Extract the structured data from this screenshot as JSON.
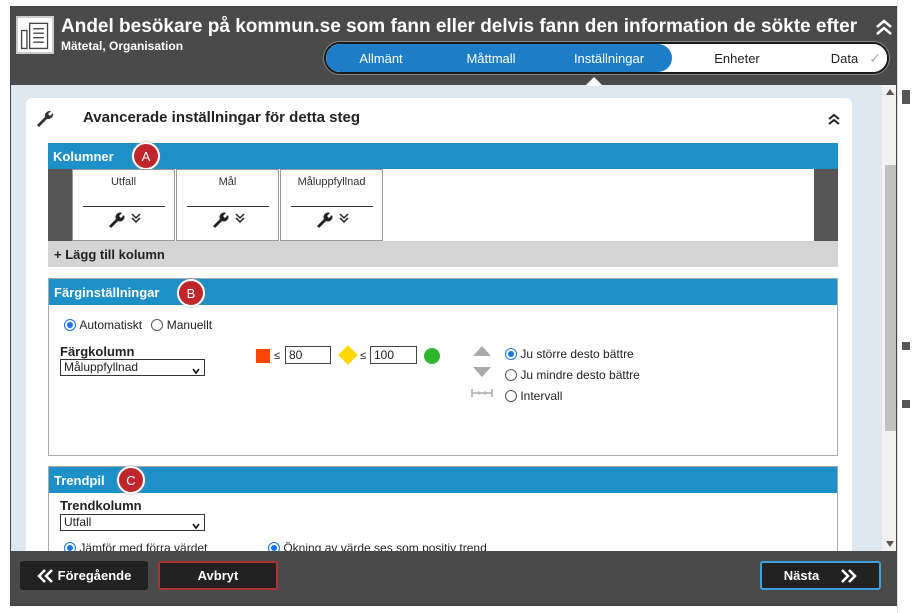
{
  "window": {
    "title": "Andel besökare på kommun.se som fann eller delvis fann den information de sökte efter",
    "subtitle": "Mätetal, Organisation"
  },
  "tabs": [
    {
      "label": "Allmänt",
      "state": "active"
    },
    {
      "label": "Måttmall",
      "state": "active"
    },
    {
      "label": "Inställningar",
      "state": "active-current"
    },
    {
      "label": "Enheter",
      "state": "inactive"
    },
    {
      "label": "Data",
      "state": "inactive"
    }
  ],
  "panel": {
    "title": "Avancerade inställningar för detta steg"
  },
  "kolumner": {
    "header": "Kolumner",
    "badge": "A",
    "columns": [
      {
        "name": "Utfall"
      },
      {
        "name": "Mål"
      },
      {
        "name": "Måluppfyllnad"
      }
    ],
    "add_label": "+ Lägg till kolumn"
  },
  "farg": {
    "header": "Färginställningar",
    "badge": "B",
    "mode_auto": "Automatiskt",
    "mode_manual": "Manuellt",
    "mode_selected": "Automatiskt",
    "column_label": "Färgkolumn",
    "column_value": "Måluppfyllnad",
    "le_symbol": "≤",
    "threshold_red": "80",
    "threshold_yellow": "100",
    "direction_options": [
      "Ju större desto bättre",
      "Ju mindre desto bättre",
      "Intervall"
    ],
    "direction_selected": "Ju större desto bättre",
    "colors": {
      "red": "#ff4500",
      "yellow": "#ffd700",
      "green": "#2db52d"
    }
  },
  "trend": {
    "header": "Trendpil",
    "badge": "C",
    "column_label": "Trendkolumn",
    "column_value": "Utfall",
    "compare_label": "Jämför med förra värdet",
    "direction_label": "Ökning av värde ses som positiv trend"
  },
  "footer": {
    "prev_label": "Föregående",
    "cancel_label": "Avbryt",
    "next_label": "Nästa"
  },
  "colors": {
    "accent": "#1e90c8",
    "tab_active": "#1d7dc6",
    "badge": "#c0272d",
    "header_bg": "#4a4a4a"
  }
}
